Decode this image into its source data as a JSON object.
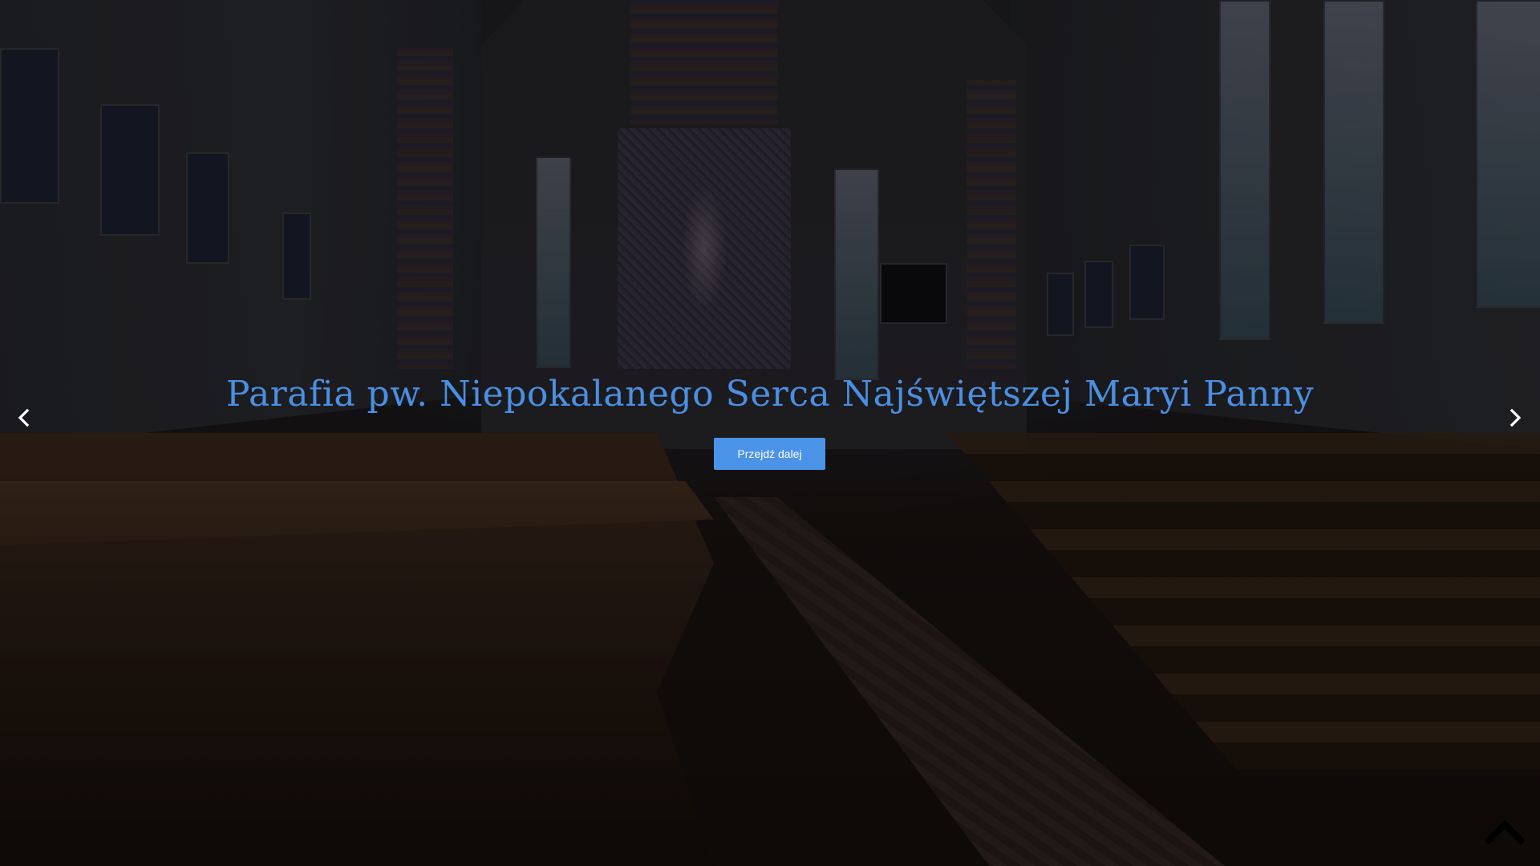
{
  "hero": {
    "title": "Parafia pw. Niepokalanego Serca Najświętszej Maryi Panny",
    "button_label": "Przejdź dalej"
  },
  "controls": {
    "prev_icon": "chevron-left-icon",
    "next_icon": "chevron-right-icon",
    "scroll_top_icon": "chevron-up-icon"
  },
  "colors": {
    "accent": "#4a93e6",
    "title": "#4a8fe3",
    "button_text": "#ffffff"
  }
}
